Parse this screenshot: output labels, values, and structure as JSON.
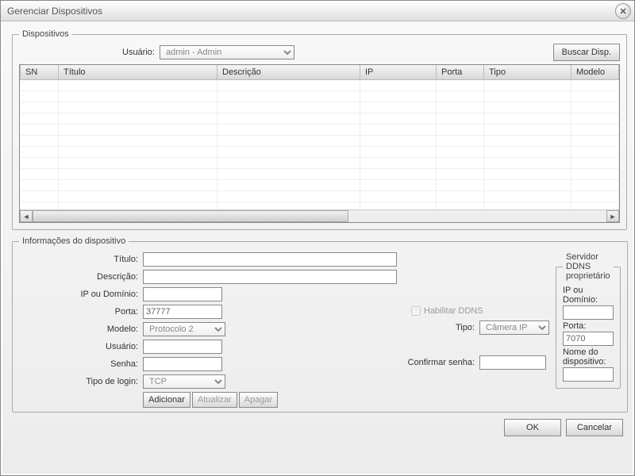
{
  "window": {
    "title": "Gerenciar Dispositivos"
  },
  "devices_group": {
    "legend": "Dispositivos",
    "user_label": "Usuário:",
    "user_selected": "admin - Admin",
    "search_btn": "Buscar Disp.",
    "columns": {
      "sn": "SN",
      "title": "Título",
      "description": "Descrição",
      "ip": "IP",
      "port": "Porta",
      "type": "Tipo",
      "model": "Modelo"
    }
  },
  "info_group": {
    "legend": "Informações do dispositivo",
    "labels": {
      "title": "Título:",
      "description": "Descrição:",
      "ip_domain": "IP ou Domínio:",
      "port": "Porta:",
      "model": "Modelo:",
      "user": "Usuário:",
      "password": "Senha:",
      "login_type": "Tipo de login:",
      "enable_ddns": "Habilitar DDNS",
      "type": "Tipo:",
      "confirm_password": "Confirmar senha:"
    },
    "values": {
      "title": "",
      "description": "",
      "ip_domain": "",
      "port": "37777",
      "model": "Protocolo 2",
      "user": "",
      "password": "",
      "login_type": "TCP",
      "type": "Câmera IP",
      "confirm_password": ""
    },
    "buttons": {
      "add": "Adicionar",
      "update": "Atualizar",
      "delete": "Apagar"
    }
  },
  "ddns_group": {
    "legend": "Servidor DDNS proprietário",
    "labels": {
      "ip_domain": "IP ou Domínio:",
      "port": "Porta:",
      "device_name": "Nome do dispositivo:"
    },
    "values": {
      "ip_domain": "",
      "port": "7070",
      "device_name": ""
    }
  },
  "footer": {
    "ok": "OK",
    "cancel": "Cancelar"
  }
}
